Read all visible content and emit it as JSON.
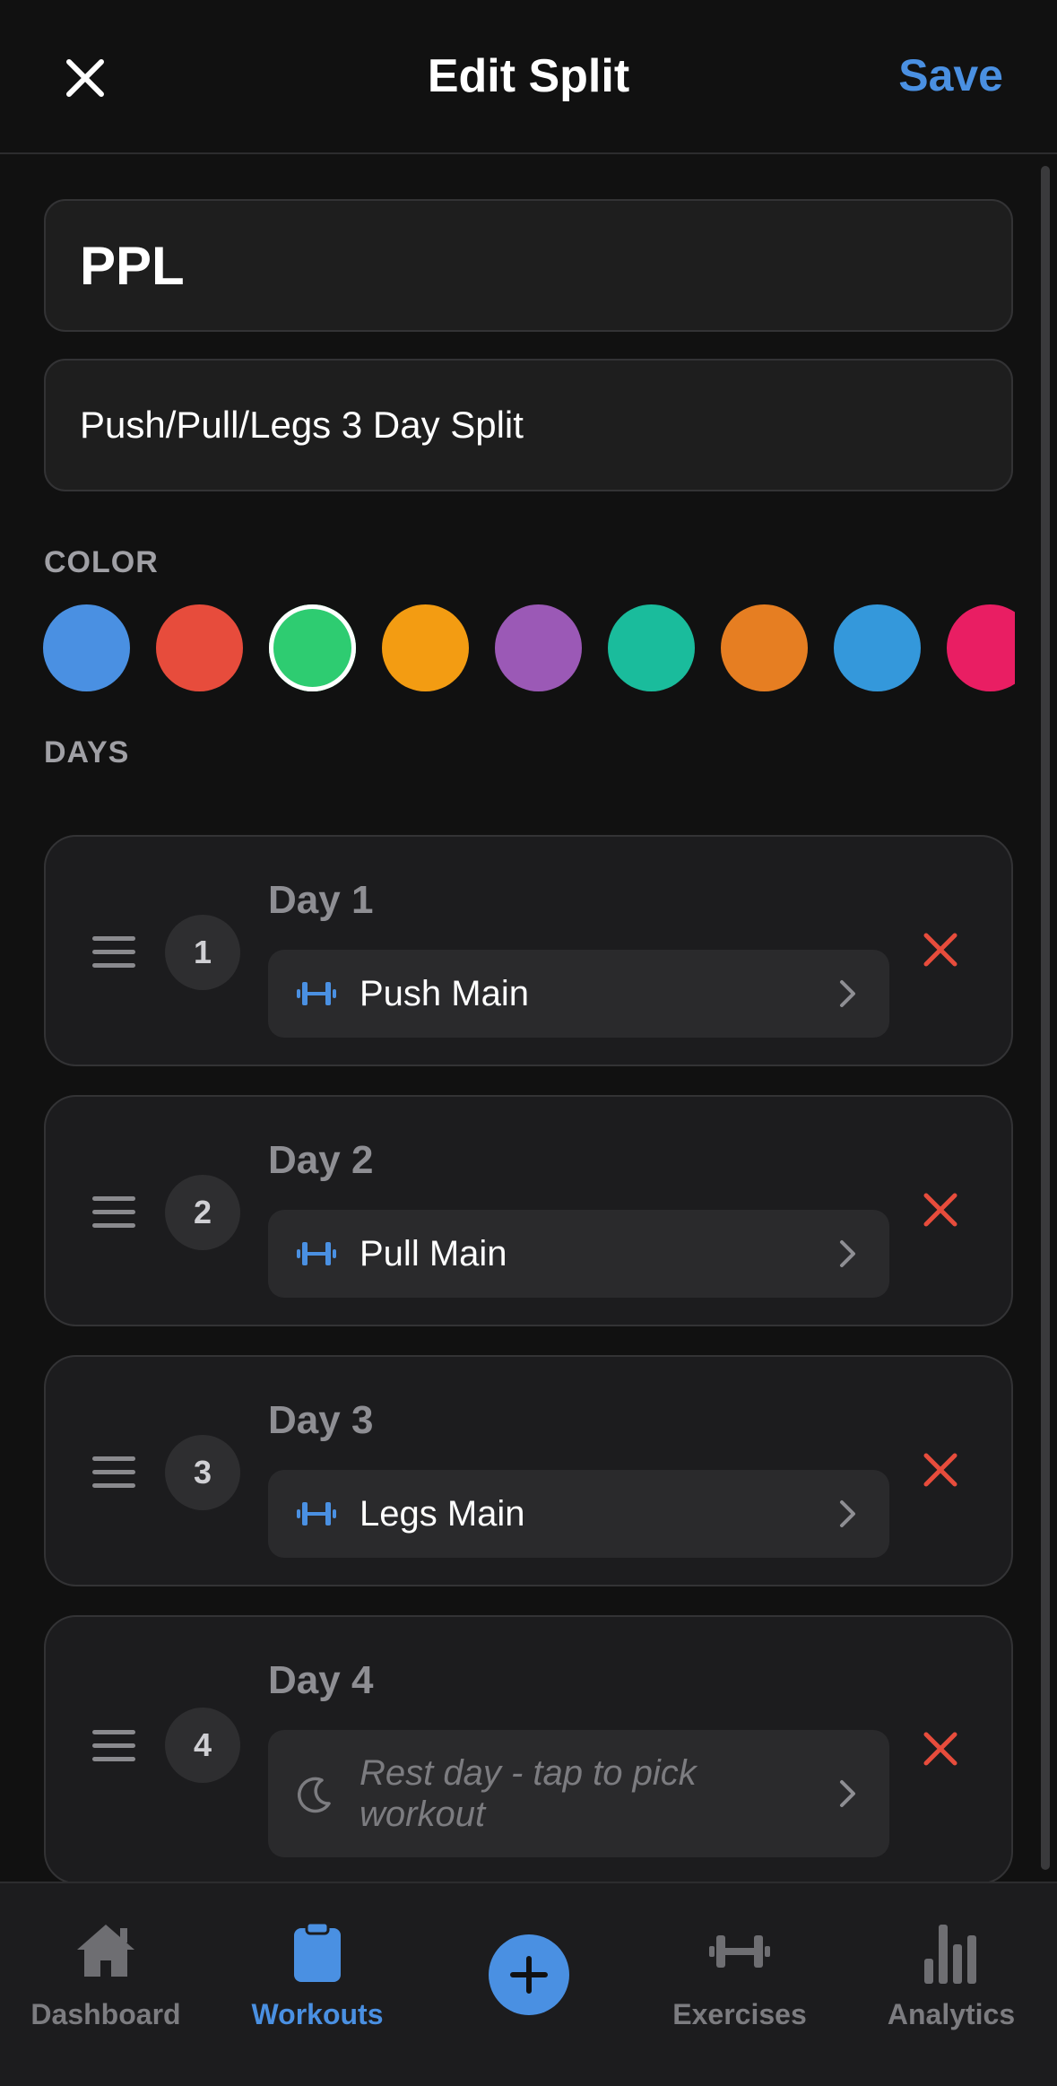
{
  "header": {
    "title": "Edit Split",
    "save_label": "Save"
  },
  "form": {
    "name_value": "PPL",
    "description_value": "Push/Pull/Legs 3 Day Split"
  },
  "sections": {
    "color_label": "COLOR",
    "days_label": "DAYS"
  },
  "colors": {
    "options": [
      "#4a90e2",
      "#e74c3c",
      "#2ecc71",
      "#f39c12",
      "#9b59b6",
      "#1abc9c",
      "#e67e22",
      "#3498db",
      "#e91e63"
    ],
    "selected_index": 2,
    "accent": "#4a90e2",
    "danger": "#e74c3c"
  },
  "days": [
    {
      "number": "1",
      "title": "Day 1",
      "workout": "Push Main",
      "rest": false,
      "icon": "dumbbell-icon"
    },
    {
      "number": "2",
      "title": "Day 2",
      "workout": "Pull Main",
      "rest": false,
      "icon": "dumbbell-icon"
    },
    {
      "number": "3",
      "title": "Day 3",
      "workout": "Legs Main",
      "rest": false,
      "icon": "dumbbell-icon"
    },
    {
      "number": "4",
      "title": "Day 4",
      "workout": "Rest day - tap to pick workout",
      "rest": true,
      "icon": "moon-icon"
    }
  ],
  "tabbar": {
    "tabs": [
      {
        "label": "Dashboard",
        "icon": "home-icon",
        "active": false
      },
      {
        "label": "Workouts",
        "icon": "clipboard-icon",
        "active": true
      },
      {
        "label": "",
        "icon": "plus-icon",
        "active": false
      },
      {
        "label": "Exercises",
        "icon": "dumbbell-icon",
        "active": false
      },
      {
        "label": "Analytics",
        "icon": "bar-chart-icon",
        "active": false
      }
    ]
  }
}
